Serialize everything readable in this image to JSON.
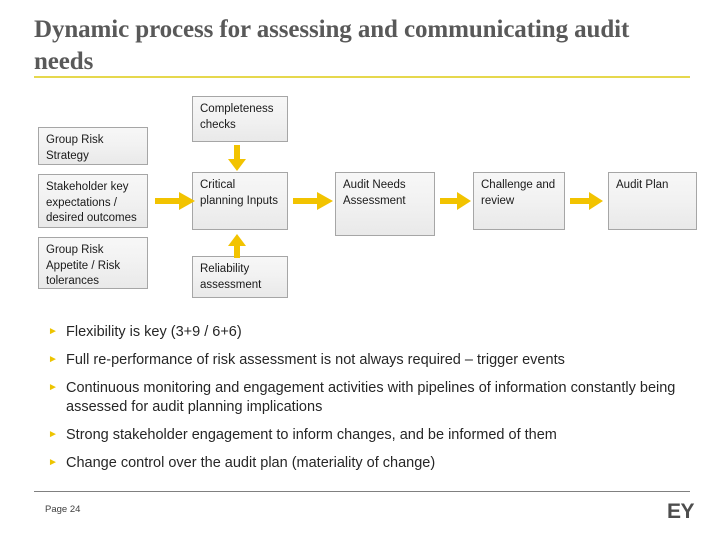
{
  "slide": {
    "title": "Dynamic process for assessing and communicating audit needs",
    "accent_color": "#e6d84e",
    "arrow_color": "#f2c300"
  },
  "diagram": {
    "inputs": [
      {
        "id": "group-risk-strategy",
        "label": "Group Risk Strategy"
      },
      {
        "id": "stakeholder",
        "label": "Stakeholder key expectations / desired outcomes"
      },
      {
        "id": "appetite",
        "label": "Group Risk Appetite / Risk tolerances"
      }
    ],
    "middle": {
      "top": {
        "id": "completeness",
        "label": "Completeness checks"
      },
      "center": {
        "id": "critical",
        "label": "Critical planning Inputs"
      },
      "bottom": {
        "id": "reliability",
        "label": "Reliability assessment"
      }
    },
    "chain": [
      {
        "id": "audit-needs",
        "label": "Audit Needs Assessment"
      },
      {
        "id": "challenge",
        "label": "Challenge and review"
      },
      {
        "id": "audit-plan",
        "label": "Audit Plan"
      }
    ],
    "arrows": [
      {
        "id": "stakeholder-to-critical",
        "direction": "right"
      },
      {
        "id": "critical-to-assessment",
        "direction": "right"
      },
      {
        "id": "assessment-to-challenge",
        "direction": "right"
      },
      {
        "id": "challenge-to-plan",
        "direction": "right"
      },
      {
        "id": "completeness-down",
        "direction": "down"
      },
      {
        "id": "reliability-up",
        "direction": "up"
      }
    ]
  },
  "bullets": {
    "marker": "►",
    "items": [
      "Flexibility is key (3+9 / 6+6)",
      "Full re-performance of risk assessment is not always required – trigger events",
      "Continuous monitoring and engagement activities with pipelines of information constantly being assessed for audit planning implications",
      "Strong stakeholder engagement to inform changes, and be informed of them",
      "Change control over the audit plan (materiality of change)"
    ]
  },
  "footer": {
    "page": "Page 24",
    "logo": "EY"
  }
}
